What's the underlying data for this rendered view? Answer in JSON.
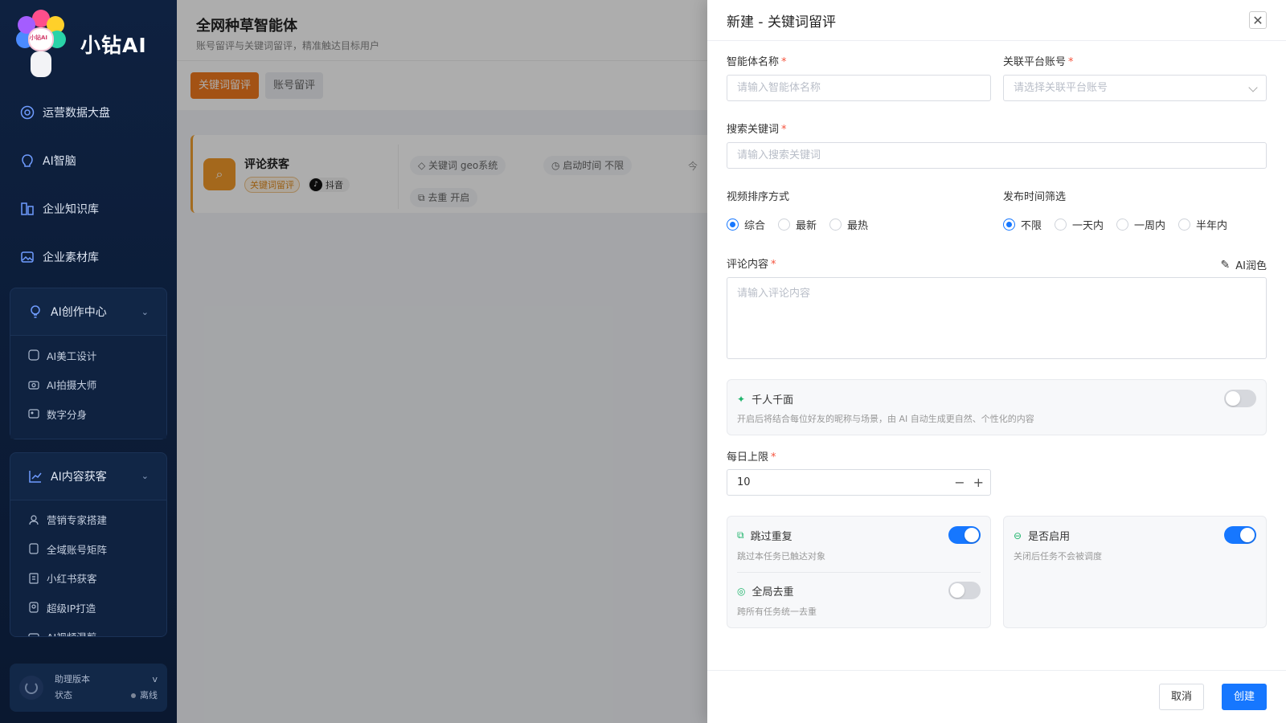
{
  "brand": {
    "name": "小钻AI",
    "badge": "小钻AI"
  },
  "nav": [
    {
      "label": "运营数据大盘",
      "icon": "dashboard-icon"
    },
    {
      "label": "AI智脑",
      "icon": "brain-icon"
    },
    {
      "label": "企业知识库",
      "icon": "library-icon"
    },
    {
      "label": "企业素材库",
      "icon": "image-icon"
    }
  ],
  "groups": [
    {
      "label": "AI创作中心",
      "items": [
        "AI美工设计",
        "AI拍摄大师",
        "数字分身"
      ]
    },
    {
      "label": "AI内容获客",
      "items": [
        "营销专家搭建",
        "全域账号矩阵",
        "小红书获客",
        "超级IP打造",
        "AI视频混剪"
      ]
    }
  ],
  "sidebar_footer": {
    "version_label": "助理版本",
    "version_value": "v",
    "status_label": "状态",
    "status_value": "离线"
  },
  "main": {
    "title": "全网种草智能体",
    "subtitle": "账号留评与关键词留评，精准触达目标用户",
    "tabs": [
      "关键词留评",
      "账号留评"
    ],
    "card": {
      "title": "评论获客",
      "tag": "关键词留评",
      "platform": "抖音",
      "pills": [
        "关键词 geo系统",
        "启动时间 不限",
        "去重 开启"
      ],
      "today_label": "今"
    }
  },
  "drawer": {
    "title": "新建 - 关键词留评",
    "agent_name": {
      "label": "智能体名称",
      "placeholder": "请输入智能体名称"
    },
    "platform_account": {
      "label": "关联平台账号",
      "placeholder": "请选择关联平台账号"
    },
    "keyword": {
      "label": "搜索关键词",
      "placeholder": "请输入搜索关键词"
    },
    "sort": {
      "label": "视频排序方式",
      "options": [
        "综合",
        "最新",
        "最热"
      ],
      "selected": "综合"
    },
    "time_filter": {
      "label": "发布时间筛选",
      "options": [
        "不限",
        "一天内",
        "一周内",
        "半年内"
      ],
      "selected": "不限"
    },
    "comment": {
      "label": "评论内容",
      "placeholder": "请输入评论内容",
      "ai_polish": "AI润色"
    },
    "personalize": {
      "title": "千人千面",
      "desc": "开启后将结合每位好友的昵称与场景，由 AI 自动生成更自然、个性化的内容",
      "enabled": false
    },
    "daily_limit": {
      "label": "每日上限",
      "value": "10"
    },
    "skip_dup": {
      "title": "跳过重复",
      "desc": "跳过本任务已触达对象",
      "enabled": true
    },
    "global_dedup": {
      "title": "全局去重",
      "desc": "跨所有任务统一去重",
      "enabled": false
    },
    "enable": {
      "title": "是否启用",
      "desc": "关闭后任务不会被调度",
      "enabled": true
    },
    "buttons": {
      "cancel": "取消",
      "create": "创建"
    }
  },
  "colors": {
    "primary": "#1677ff",
    "accent": "#f07a1e",
    "sidebar_bg": "#0e2140",
    "toggle_off": "#d6d8dd"
  }
}
